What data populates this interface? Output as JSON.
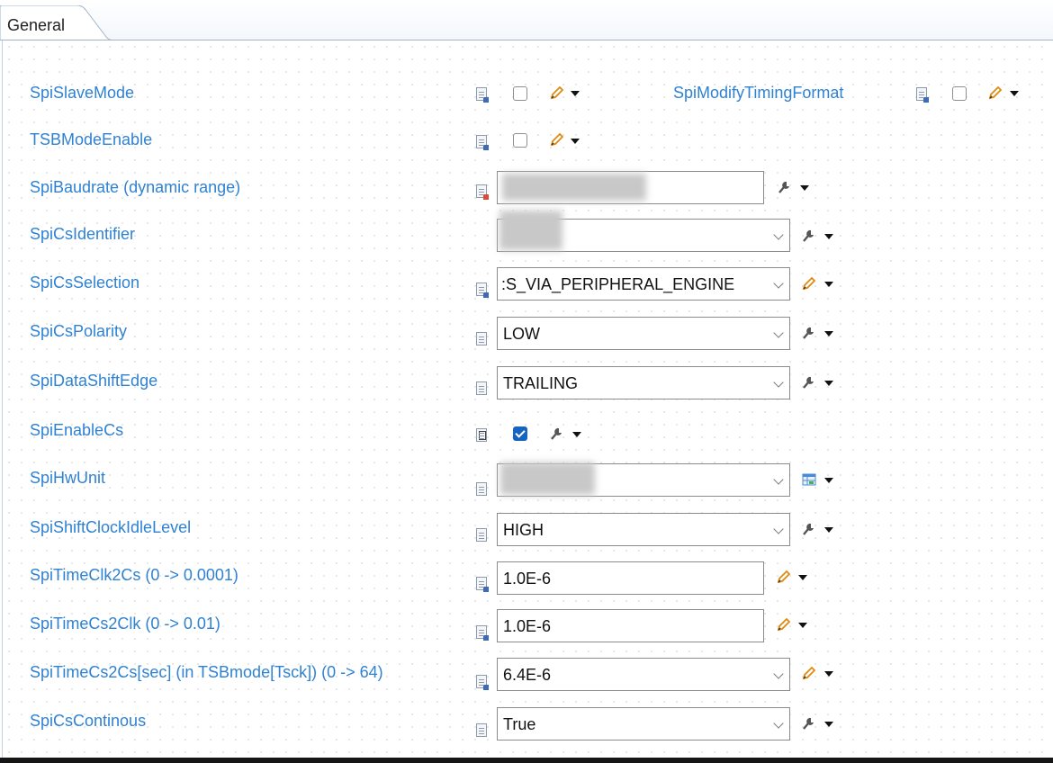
{
  "tab": {
    "label": "General"
  },
  "rows": {
    "spi_slave_mode": {
      "label": "SpiSlaveMode",
      "checked": false
    },
    "spi_modify_timing_format": {
      "label": "SpiModifyTimingFormat",
      "checked": false
    },
    "tsb_mode_enable": {
      "label": "TSBModeEnable",
      "checked": false
    },
    "spi_baudrate": {
      "label": "SpiBaudrate (dynamic range)",
      "value": ""
    },
    "spi_cs_identifier": {
      "label": "SpiCsIdentifier",
      "value": ""
    },
    "spi_cs_selection": {
      "label": "SpiCsSelection",
      "value": ":S_VIA_PERIPHERAL_ENGINE"
    },
    "spi_cs_polarity": {
      "label": "SpiCsPolarity",
      "value": "LOW"
    },
    "spi_data_shift_edge": {
      "label": "SpiDataShiftEdge",
      "value": "TRAILING"
    },
    "spi_enable_cs": {
      "label": "SpiEnableCs",
      "checked": true
    },
    "spi_hw_unit": {
      "label": "SpiHwUnit",
      "value": ""
    },
    "spi_shift_clock_idle_level": {
      "label": "SpiShiftClockIdleLevel",
      "value": "HIGH"
    },
    "spi_time_clk2cs": {
      "label": "SpiTimeClk2Cs (0 -> 0.0001)",
      "value": "1.0E-6"
    },
    "spi_time_cs2clk": {
      "label": "SpiTimeCs2Clk (0 -> 0.01)",
      "value": "1.0E-6"
    },
    "spi_time_cs2cs": {
      "label": "SpiTimeCs2Cs[sec] (in TSBmode[Tsck]) (0 -> 64)",
      "value": "6.4E-6"
    },
    "spi_cs_continous": {
      "label": "SpiCsContinous",
      "value": "True"
    }
  },
  "icons": {
    "edit": "pencil-icon",
    "wrench": "wrench-icon",
    "table": "table-icon",
    "dropdown": "caret-down-icon",
    "file": "config-file-icon"
  },
  "colors": {
    "label": "#2f82d2",
    "checkbox_checked": "#1565c0",
    "pencil": "#e08a12"
  }
}
